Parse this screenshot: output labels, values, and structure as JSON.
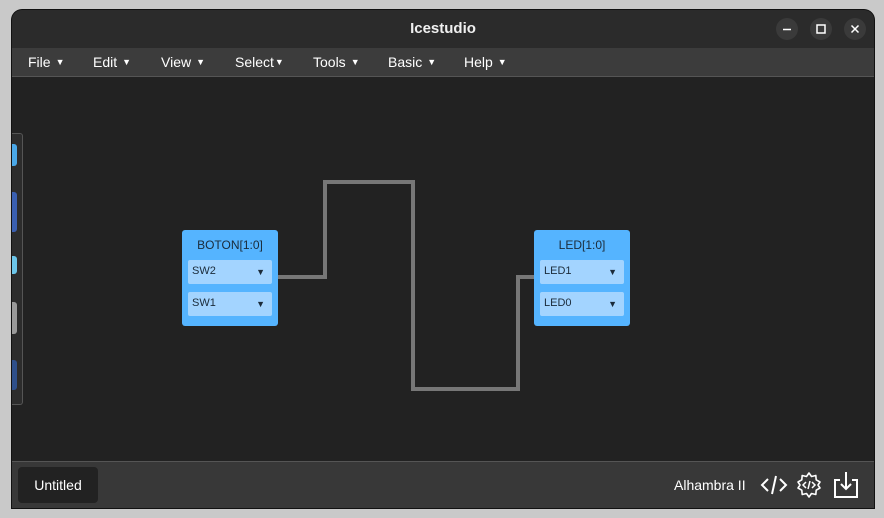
{
  "window": {
    "title": "Icestudio"
  },
  "menu": [
    {
      "label": "File"
    },
    {
      "label": "Edit"
    },
    {
      "label": "View"
    },
    {
      "label": "Select"
    },
    {
      "label": "Tools"
    },
    {
      "label": "Basic"
    },
    {
      "label": "Help"
    }
  ],
  "blocks": {
    "input": {
      "name": "BOTON[1:0]",
      "ports": [
        {
          "label": "SW2"
        },
        {
          "label": "SW1"
        }
      ]
    },
    "output": {
      "name": "LED[1:0]",
      "ports": [
        {
          "label": "LED1"
        },
        {
          "label": "LED0"
        }
      ]
    }
  },
  "status": {
    "tab": "Untitled",
    "board": "Alhambra II"
  },
  "icons": {
    "verify": "code-icon",
    "build": "gear-code-icon",
    "upload": "download-icon"
  },
  "colors": {
    "block": "#55b4ff",
    "port": "#a3d4ff",
    "wire": "#777777",
    "canvas": "#222222"
  }
}
